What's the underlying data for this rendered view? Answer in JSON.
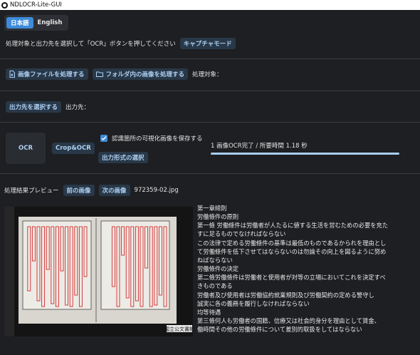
{
  "window": {
    "title": "NDLOCR-Lite-GUI"
  },
  "language": {
    "options": [
      "日本語",
      "English"
    ],
    "selected": "日本語"
  },
  "instruction": {
    "text": "処理対象と出力先を選択して「OCR」ボタンを押してください",
    "capture_mode_label": "キャプチャモード"
  },
  "source": {
    "process_image_file_label": "画像ファイルを処理する",
    "process_folder_label": "フォルダ内の画像を処理する",
    "target_label": "処理対象："
  },
  "output": {
    "select_output_label": "出力先を選択する",
    "output_label": "出力先："
  },
  "actions": {
    "ocr_label": "OCR",
    "crop_ocr_label": "Crop&OCR",
    "save_visualization_label": "認識箇所の可視化画像を保存する",
    "save_visualization_checked": true,
    "output_format_label": "出力形式の選択"
  },
  "status": {
    "text": "1 画像OCR完了 / 所要時間 1.18 秒",
    "progress": 1.0
  },
  "preview": {
    "label": "処理結果プレビュー",
    "prev_label": "前の画像",
    "next_label": "次の画像",
    "filename": "972359-02.jpg"
  },
  "ocr_result_lines": [
    "第一章總則",
    "労働條件の原則",
    "第一條 労働條件は労働者が人たるに値する生活を営むための必要を充た",
    "すに足るものでなければならない",
    "この法律で定める労働條件の基準は最低のものであるかられを理由とし",
    "て労働條件を低下させてはならないのは勿論その向上を図るように努め",
    "ねばならない",
    "労働條件の決定",
    "第二條労働條件は労働者と使用者が対等の立場においてこれを決定すべ",
    "きものである",
    "労働者及び使用者は労働協約就業規則及び労働契約の定める警守し",
    "誠実に各の義務を履行しなければならない",
    "均等待遇",
    "第三條何人も労働者の国籍、信療又は社会的身分を理由として賃金、",
    "働時間その他の労働條件について差別的取扱をしてはならない"
  ],
  "document_stamp": "国立公文書館",
  "colors": {
    "accent": "#3d8bd9",
    "chip_text": "#aed0f2",
    "chip_bg": "#283848",
    "background": "#1e1f22",
    "ocr_box": "#d42a2a"
  },
  "icons": {
    "file": "file-plus-icon",
    "folder": "folder-icon",
    "check": "check-icon"
  }
}
